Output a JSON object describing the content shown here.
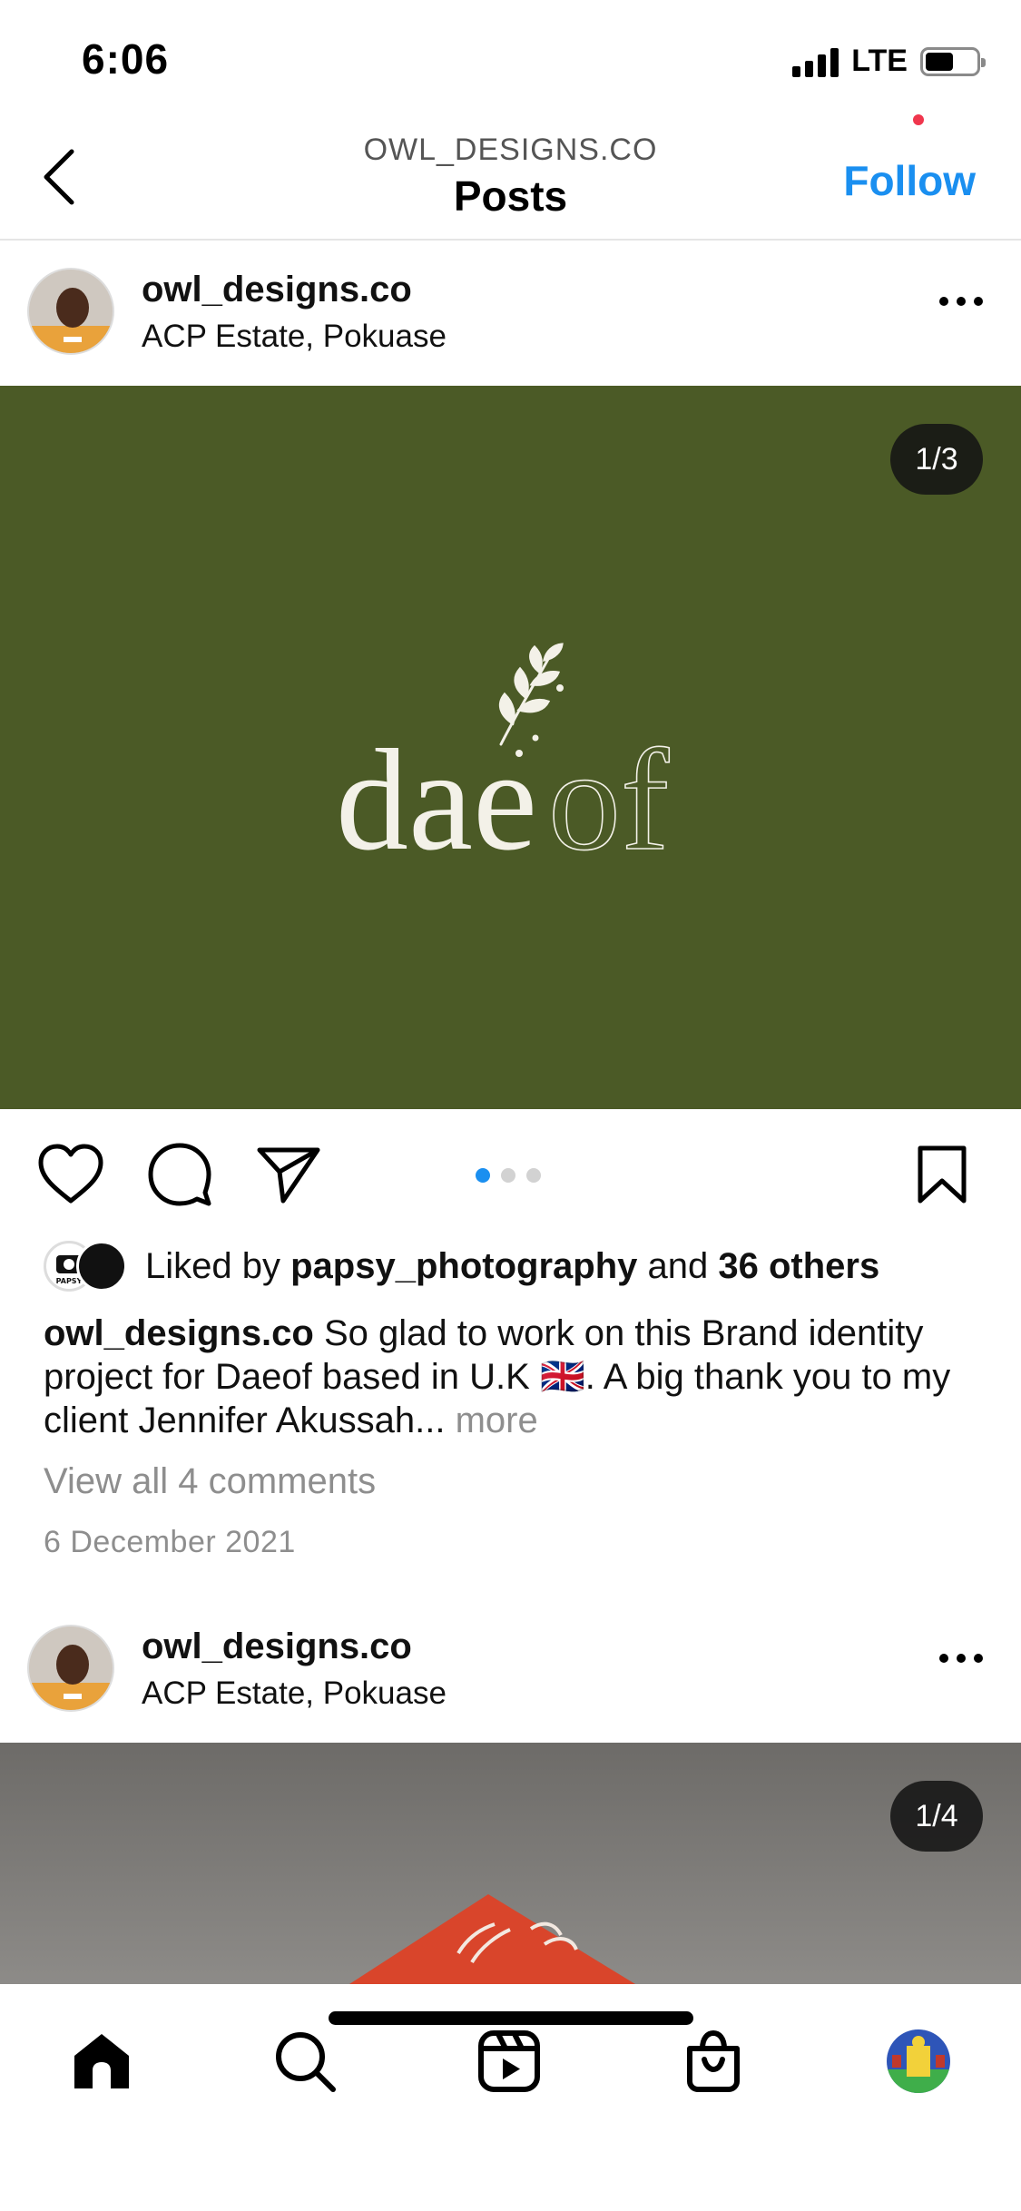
{
  "status_bar": {
    "time": "6:06",
    "network": "LTE",
    "battery_level": 0.55
  },
  "header": {
    "subtitle": "OWL_DESIGNS.CO",
    "title": "Posts",
    "follow_label": "Follow",
    "accent_color": "#1a8ff0"
  },
  "posts": [
    {
      "username": "owl_designs.co",
      "location": "ACP Estate, Pokuase",
      "counter": "1/3",
      "image_bg": "#4b5a26",
      "logo_text_bold": "dae",
      "logo_text_outline": "of",
      "carousel_count": 3,
      "carousel_active": 1,
      "likes_prefix": "Liked by",
      "liked_by_user": "papsy_photography",
      "likes_connector": "and",
      "likes_others": "36 others",
      "caption_user": "owl_designs.co",
      "caption_text": "So glad to work on this Brand identity project for Daeof based in U.K",
      "caption_flag": "🇬🇧",
      "caption_text_after": ". A big thank you to my client Jennifer Akussah...",
      "caption_more": "more",
      "view_comments": "View all 4 comments",
      "date": "6 December 2021",
      "liker_avatar_label": "PAPSY"
    },
    {
      "username": "owl_designs.co",
      "location": "ACP Estate, Pokuase",
      "counter": "1/4",
      "image_bg": "#6e6c69"
    }
  ],
  "icons": {
    "back": "chevron-left-icon",
    "more": "more-horizontal-icon",
    "like": "heart-icon",
    "comment": "comment-icon",
    "share": "send-icon",
    "save": "bookmark-icon",
    "nav": [
      "home-icon",
      "search-icon",
      "reels-icon",
      "shop-icon",
      "profile-avatar"
    ]
  }
}
